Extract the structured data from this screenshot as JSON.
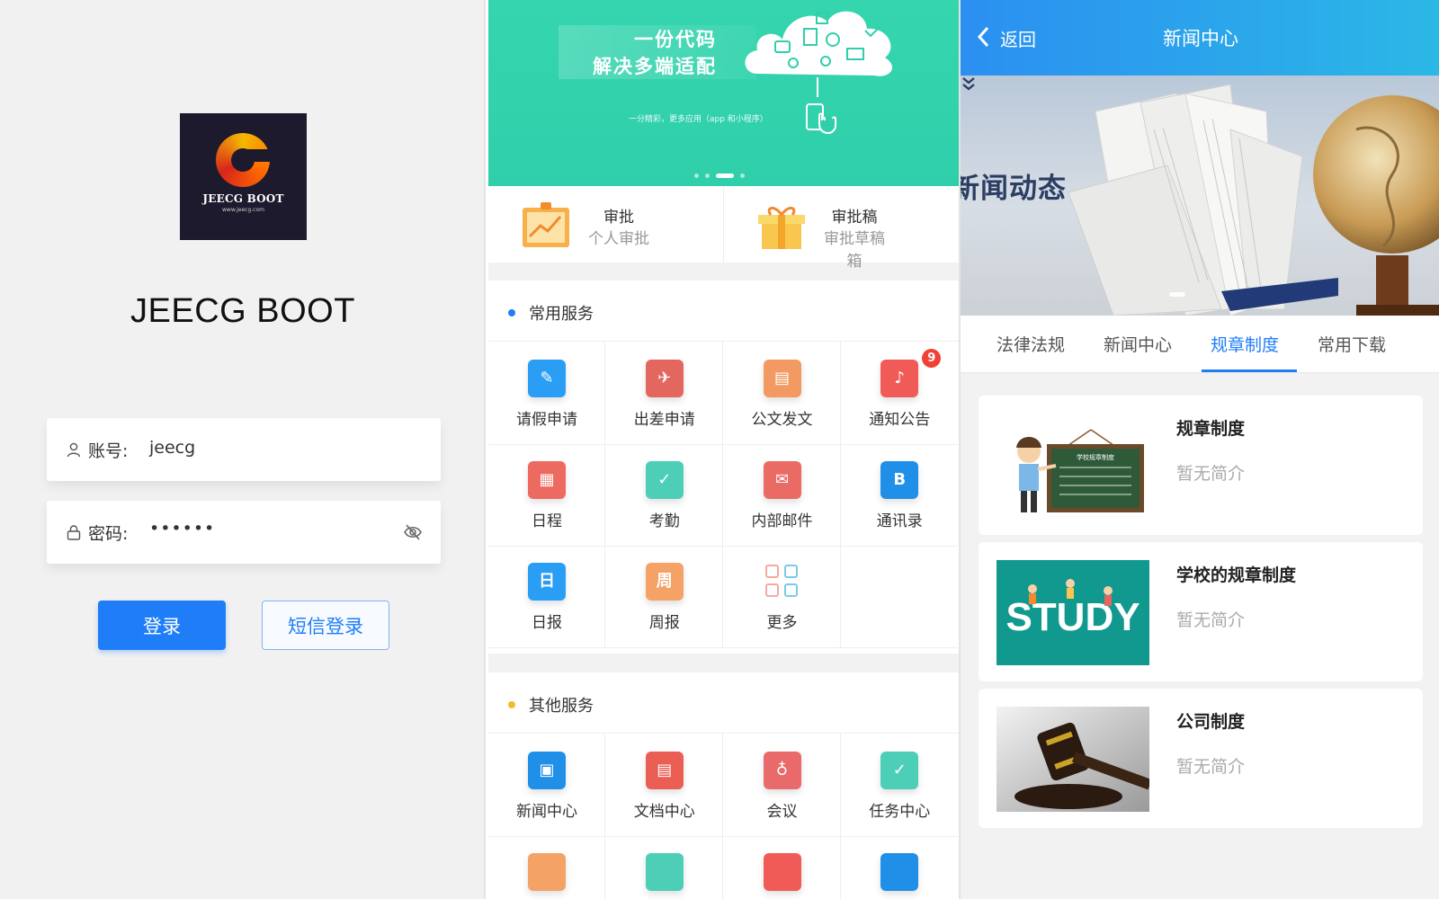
{
  "login": {
    "logo_text": "JEECG BOOT",
    "logo_sub": "www.jeecg.com",
    "app_title": "JEECG BOOT",
    "account_label": "账号:",
    "account_value": "jeecg",
    "password_label": "密码:",
    "password_value": "••••••",
    "login_button": "登录",
    "sms_button": "短信登录"
  },
  "home": {
    "banner": {
      "line1": "一份代码",
      "line2": "解决多端适配",
      "small": "一分精彩，更多应用（app 和小程序）",
      "dots": 4,
      "active_dot": 3
    },
    "approvals": [
      {
        "title": "审批",
        "subtitle": "个人审批",
        "icon": "chart-board-icon"
      },
      {
        "title": "审批稿",
        "subtitle": "审批草稿箱",
        "icon": "gift-box-icon"
      }
    ],
    "common_services": {
      "title": "常用服务",
      "dot_color": "#1f7df8",
      "items": [
        {
          "label": "请假申请",
          "icon": "leave-request-icon",
          "color": "#2a9df4",
          "glyph": "✎"
        },
        {
          "label": "出差申请",
          "icon": "airplane-icon",
          "color": "#e4675f",
          "glyph": "✈"
        },
        {
          "label": "公文发文",
          "icon": "briefcase-icon",
          "color": "#f29a61",
          "glyph": "▤"
        },
        {
          "label": "通知公告",
          "icon": "bell-icon",
          "color": "#f15b57",
          "glyph": "♪",
          "badge": "9"
        },
        {
          "label": "日程",
          "icon": "calendar-icon",
          "color": "#ec6a60",
          "glyph": "▦"
        },
        {
          "label": "考勤",
          "icon": "attendance-icon",
          "color": "#4ccfb6",
          "glyph": "✓"
        },
        {
          "label": "内部邮件",
          "icon": "mail-icon",
          "color": "#ea6a64",
          "glyph": "✉"
        },
        {
          "label": "通讯录",
          "icon": "contacts-icon",
          "color": "#1f8fe8",
          "glyph": "B"
        },
        {
          "label": "日报",
          "icon": "daily-report-icon",
          "color": "#2a9df4",
          "glyph": "日"
        },
        {
          "label": "周报",
          "icon": "weekly-report-icon",
          "color": "#f5a266",
          "glyph": "周"
        },
        {
          "label": "更多",
          "icon": "more-grid-icon",
          "color": "#f7a8a0",
          "glyph": ""
        }
      ]
    },
    "other_services": {
      "title": "其他服务",
      "dot_color": "#f5b82e",
      "items": [
        {
          "label": "新闻中心",
          "icon": "news-icon",
          "color": "#1f8fe8",
          "glyph": "▣"
        },
        {
          "label": "文档中心",
          "icon": "document-icon",
          "color": "#ea5e54",
          "glyph": "▤"
        },
        {
          "label": "会议",
          "icon": "meeting-icon",
          "color": "#e96a6a",
          "glyph": "♁"
        },
        {
          "label": "任务中心",
          "icon": "task-icon",
          "color": "#4ccfb6",
          "glyph": "✓"
        }
      ],
      "partial_row": [
        {
          "icon": "edit-icon",
          "color": "#f5a266"
        },
        {
          "icon": "file-icon",
          "color": "#4ccfb6"
        },
        {
          "icon": "bell-icon",
          "color": "#f15b57"
        },
        {
          "icon": "handshake-icon",
          "color": "#1f8fe8"
        }
      ]
    }
  },
  "news": {
    "back_label": "返回",
    "title": "新闻中心",
    "hero_title": "新闻动态",
    "tabs": [
      "法律法规",
      "新闻中心",
      "规章制度",
      "常用下载"
    ],
    "active_tab": 2,
    "items": [
      {
        "title": "规章制度",
        "desc": "暂无简介",
        "thumb": "teacher-blackboard"
      },
      {
        "title": "学校的规章制度",
        "desc": "暂无简介",
        "thumb": "study"
      },
      {
        "title": "公司制度",
        "desc": "暂无简介",
        "thumb": "gavel"
      }
    ],
    "thumb_texts": {
      "blackboard": "学校规章制度",
      "study": "STUDY"
    }
  }
}
